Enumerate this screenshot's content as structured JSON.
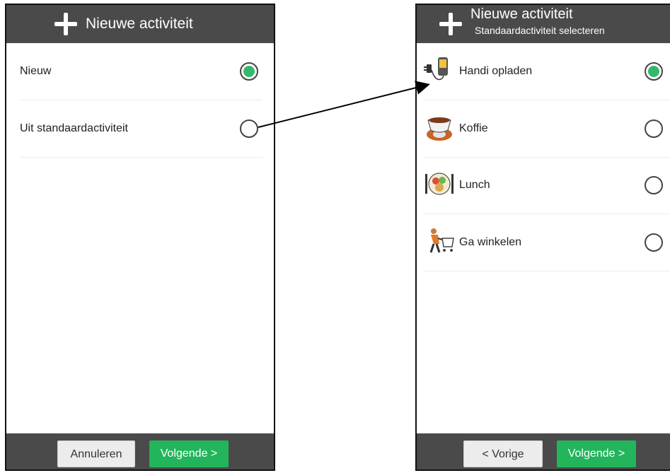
{
  "left_screen": {
    "header": {
      "title": "Nieuwe activiteit"
    },
    "options": [
      {
        "label": "Nieuw",
        "selected": true
      },
      {
        "label": "Uit standaardactiviteit",
        "selected": false
      }
    ],
    "footer": {
      "cancel_label": "Annuleren",
      "next_label": "Volgende >"
    }
  },
  "right_screen": {
    "header": {
      "title": "Nieuwe activiteit",
      "subtitle": "Standaardactiviteit selecteren"
    },
    "activities": [
      {
        "label": "Handi opladen",
        "icon": "phone-charger-icon",
        "selected": true
      },
      {
        "label": "Koffie",
        "icon": "coffee-cup-icon",
        "selected": false
      },
      {
        "label": "Lunch",
        "icon": "lunch-plate-icon",
        "selected": false
      },
      {
        "label": "Ga winkelen",
        "icon": "shopping-cart-icon",
        "selected": false
      }
    ],
    "footer": {
      "back_label": "< Vorige",
      "next_label": "Volgende >"
    }
  },
  "colors": {
    "header_bg": "#4a4a4a",
    "accent_green": "#34b86b",
    "button_green": "#23b55c"
  }
}
